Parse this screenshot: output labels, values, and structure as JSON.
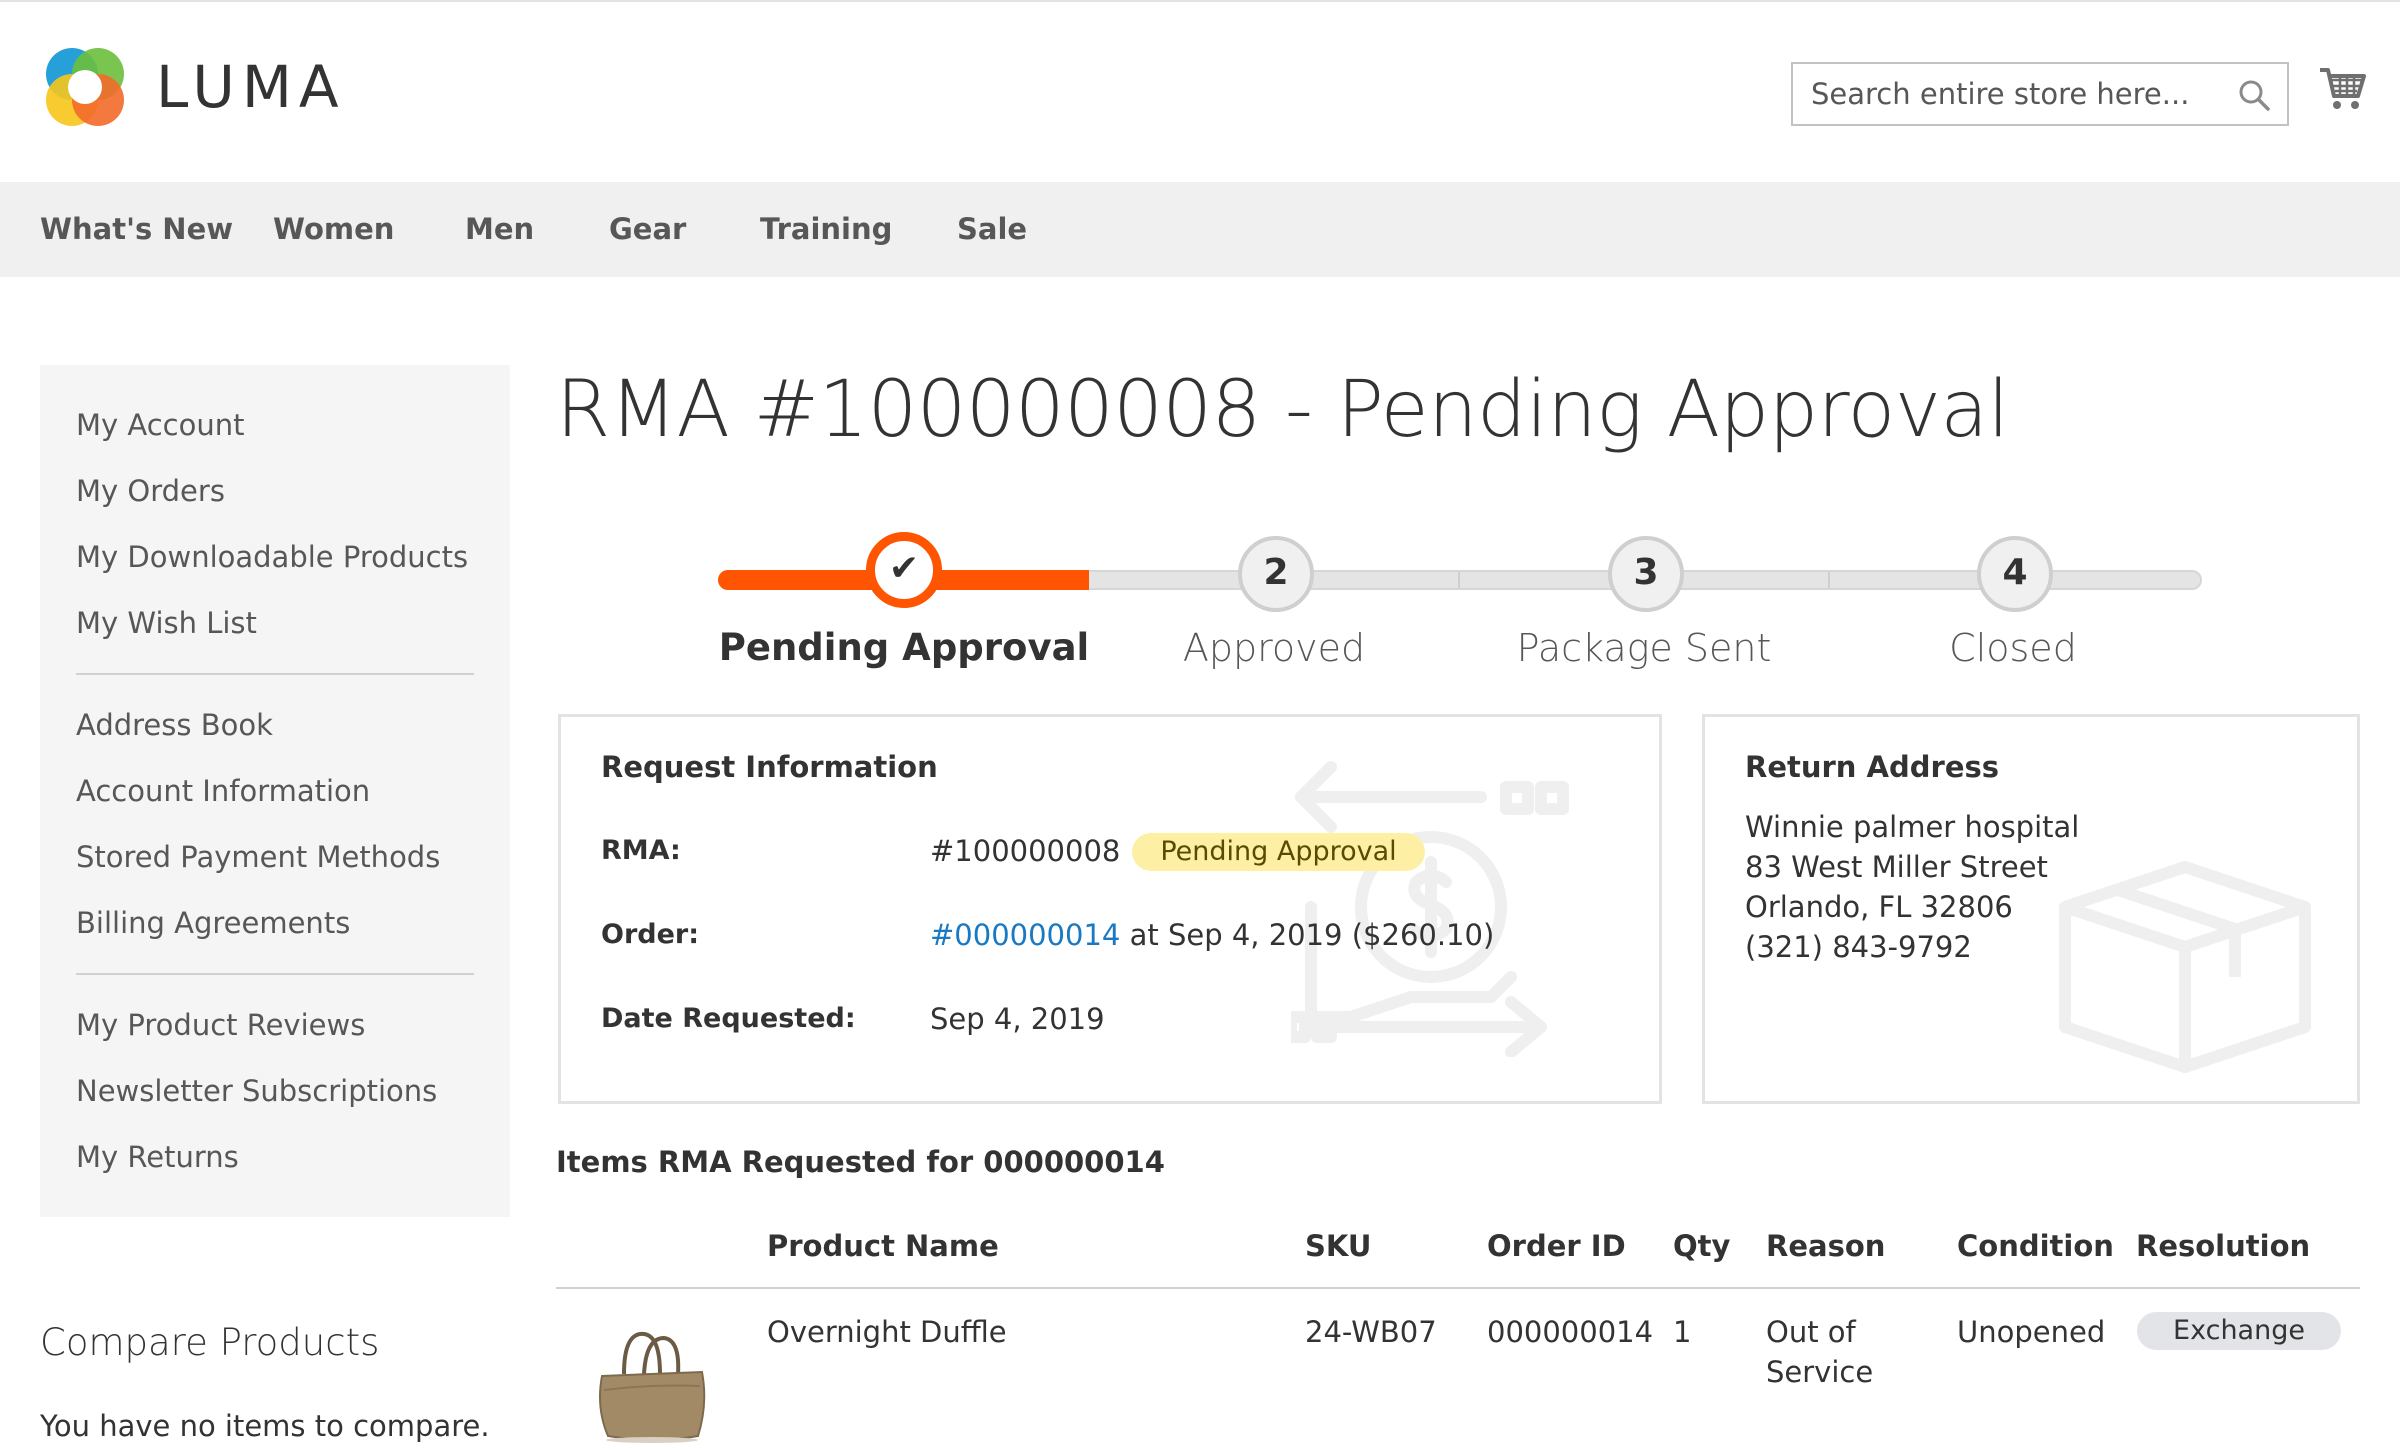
{
  "header": {
    "logo_text": "LUMA",
    "search": {
      "placeholder": "Search entire store here..."
    },
    "icons": {
      "search": "search-icon",
      "cart": "cart-icon"
    }
  },
  "nav": {
    "items": [
      {
        "label": "What's New"
      },
      {
        "label": "Women"
      },
      {
        "label": "Men"
      },
      {
        "label": "Gear"
      },
      {
        "label": "Training"
      },
      {
        "label": "Sale"
      }
    ]
  },
  "sidebar": {
    "groups": [
      [
        "My Account",
        "My Orders",
        "My Downloadable Products",
        "My Wish List"
      ],
      [
        "Address Book",
        "Account Information",
        "Stored Payment Methods",
        "Billing Agreements"
      ],
      [
        "My Product Reviews",
        "Newsletter Subscriptions",
        "My Returns"
      ]
    ],
    "compare": {
      "title": "Compare Products",
      "empty": "You have no items to compare."
    }
  },
  "page": {
    "title": "RMA #100000008 - Pending Approval",
    "progress": {
      "current_step": 1,
      "steps": [
        {
          "number": "✔",
          "label": "Pending Approval"
        },
        {
          "number": "2",
          "label": "Approved"
        },
        {
          "number": "3",
          "label": "Package Sent"
        },
        {
          "number": "4",
          "label": "Closed"
        }
      ]
    },
    "request_info": {
      "title": "Request Information",
      "rma_label": "RMA:",
      "rma_value": "#100000008",
      "status_badge": "Pending Approval",
      "order_label": "Order:",
      "order_link": "#000000014",
      "order_details": "at Sep 4, 2019 ($260.10)",
      "date_label": "Date Requested:",
      "date_value": "Sep 4, 2019"
    },
    "return_address": {
      "title": "Return Address",
      "lines": [
        "Winnie palmer hospital",
        "83 West Miller Street",
        "Orlando, FL 32806",
        "(321) 843-9792"
      ]
    },
    "items": {
      "title": "Items RMA Requested for 000000014",
      "columns": [
        "Product Name",
        "SKU",
        "Order ID",
        "Qty",
        "Reason",
        "Condition",
        "Resolution"
      ],
      "rows": [
        {
          "product_name": "Overnight Duffle",
          "sku": "24-WB07",
          "order_id": "000000014",
          "qty": "1",
          "reason": "Out of Service",
          "condition": "Unopened",
          "resolution": "Exchange"
        }
      ]
    }
  },
  "colors": {
    "accent": "#ff5501",
    "link": "#1979c3",
    "badge_bg": "#fdf0a4",
    "nav_bg": "#f0f0f0",
    "sidebar_bg": "#f5f5f5"
  }
}
